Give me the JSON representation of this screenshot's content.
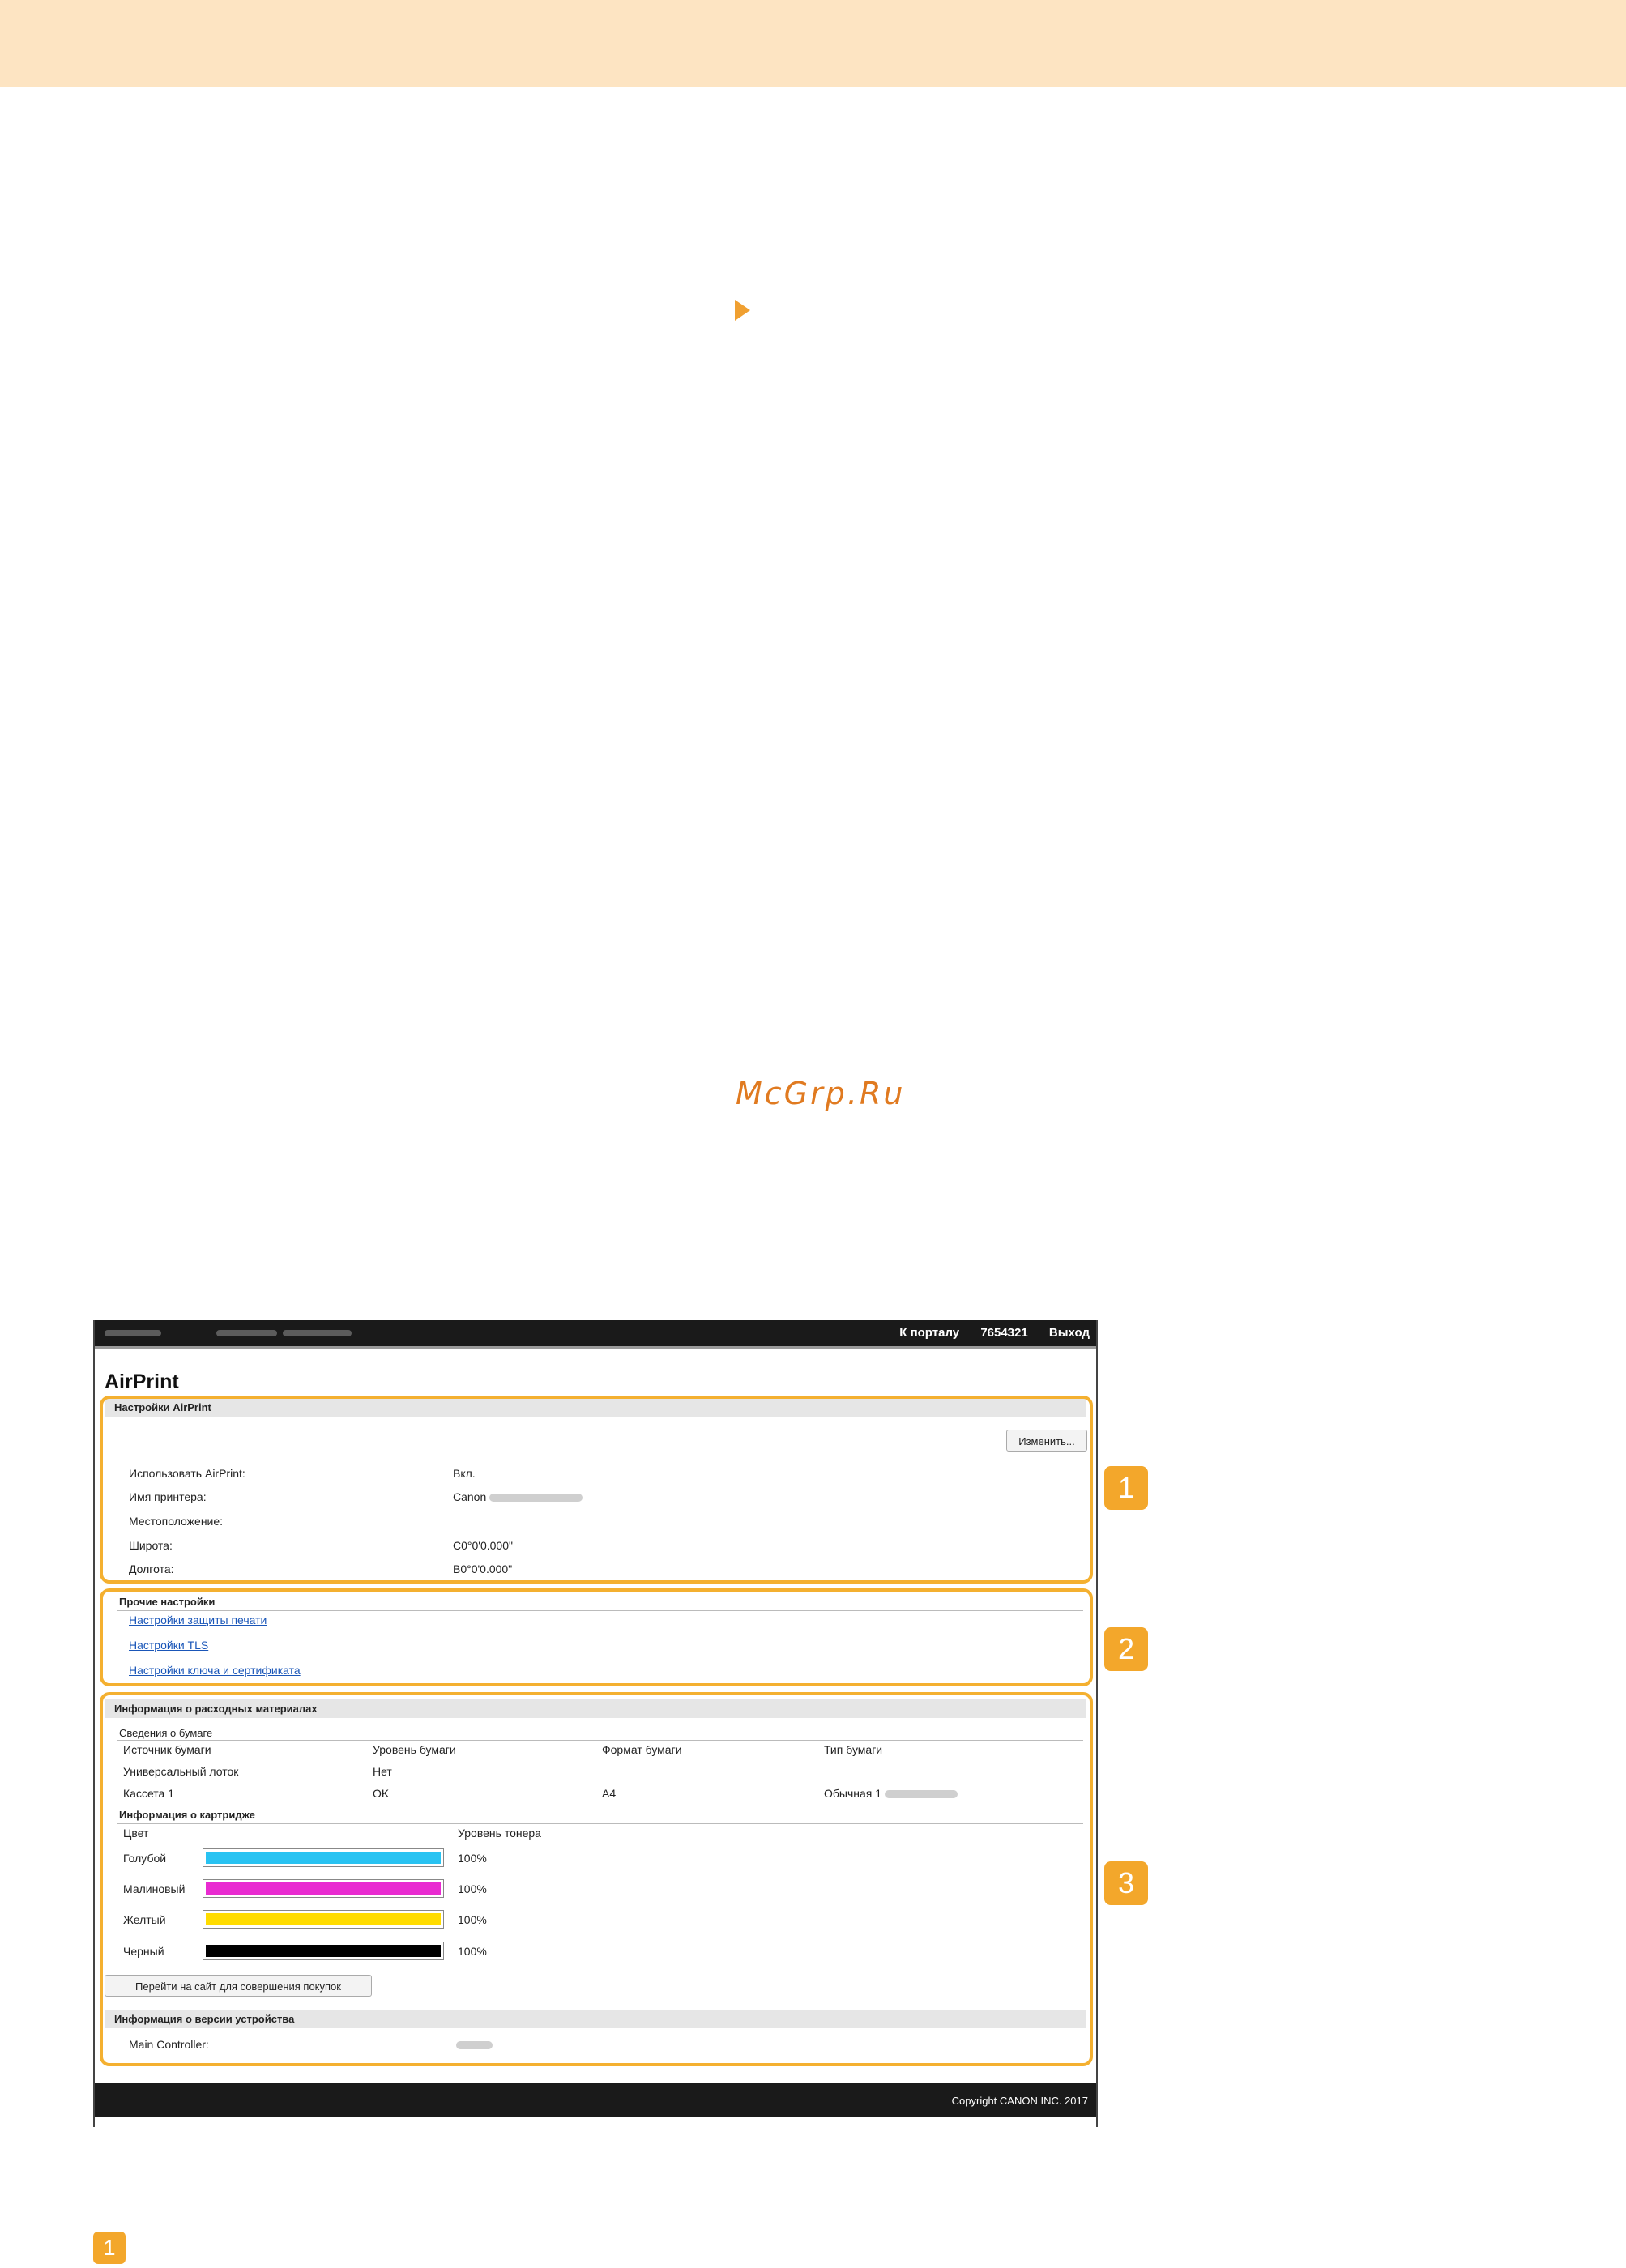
{
  "watermark": "McGrp.Ru",
  "header": {
    "portal_link": "К порталу",
    "user_id": "7654321",
    "logout": "Выход"
  },
  "app_title": "AirPrint",
  "airprint_settings": {
    "title": "Настройки AirPrint",
    "edit_button": "Изменить...",
    "rows": [
      {
        "label": "Использовать AirPrint:",
        "value": "Вкл."
      },
      {
        "label": "Имя принтера:",
        "value": "Canon"
      },
      {
        "label": "Местоположение:",
        "value": ""
      },
      {
        "label": "Широта:",
        "value": "C0°0'0.000\""
      },
      {
        "label": "Долгота:",
        "value": "В0°0'0.000\""
      }
    ]
  },
  "other_settings": {
    "title": "Прочие настройки",
    "links": [
      "Настройки защиты печати",
      "Настройки TLS",
      "Настройки ключа и сертификата"
    ]
  },
  "consumables": {
    "title": "Информация о расходных материалах",
    "paper_title": "Сведения о бумаге",
    "paper_columns": [
      "Источник бумаги",
      "Уровень бумаги",
      "Формат бумаги",
      "Тип бумаги"
    ],
    "paper_rows": [
      [
        "Универсальный лоток",
        "Нет",
        "",
        ""
      ],
      [
        "Кассета 1",
        "OK",
        "A4",
        "Обычная 1"
      ]
    ],
    "cartridge_title": "Информация о картридже",
    "cartridge_columns": [
      "Цвет",
      "Уровень тонера"
    ],
    "cartridges": [
      {
        "name": "Голубой",
        "level": "100%",
        "color": "#29c3f2"
      },
      {
        "name": "Малиновый",
        "level": "100%",
        "color": "#e92bd1"
      },
      {
        "name": "Желтый",
        "level": "100%",
        "color": "#ffdc00"
      },
      {
        "name": "Черный",
        "level": "100%",
        "color": "#000000"
      }
    ],
    "shop_button": "Перейти на сайт для совершения покупок"
  },
  "device_version": {
    "title": "Информация о версии устройства",
    "label": "Main Controller:"
  },
  "footer": {
    "copyright": "Copyright CANON INC. 2017"
  },
  "callouts": [
    "1",
    "2",
    "3"
  ],
  "bottom_badge": "1"
}
